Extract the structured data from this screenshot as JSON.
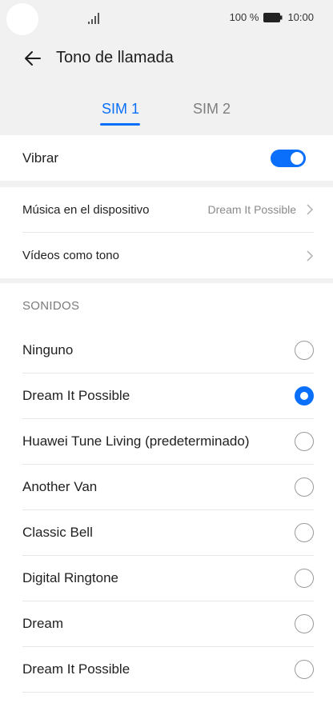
{
  "status_bar": {
    "battery_text": "100 %",
    "time": "10:00"
  },
  "header": {
    "title": "Tono de llamada"
  },
  "tabs": [
    {
      "label": "SIM 1",
      "selected": true
    },
    {
      "label": "SIM 2",
      "selected": false
    }
  ],
  "vibrate": {
    "label": "Vibrar",
    "enabled": true
  },
  "sources": [
    {
      "label": "Música en el dispositivo",
      "value": "Dream It Possible"
    },
    {
      "label": "Vídeos como tono",
      "value": ""
    }
  ],
  "sounds": {
    "section_title": "SONIDOS",
    "items": [
      {
        "label": "Ninguno",
        "selected": false
      },
      {
        "label": "Dream It Possible",
        "selected": true
      },
      {
        "label": "Huawei Tune Living (predeterminado)",
        "selected": false
      },
      {
        "label": "Another Van",
        "selected": false
      },
      {
        "label": "Classic Bell",
        "selected": false
      },
      {
        "label": "Digital Ringtone",
        "selected": false
      },
      {
        "label": "Dream",
        "selected": false
      },
      {
        "label": "Dream It Possible",
        "selected": false
      }
    ]
  },
  "colors": {
    "accent": "#0a6ffb",
    "background": "#f1f1f1",
    "card": "#ffffff"
  }
}
